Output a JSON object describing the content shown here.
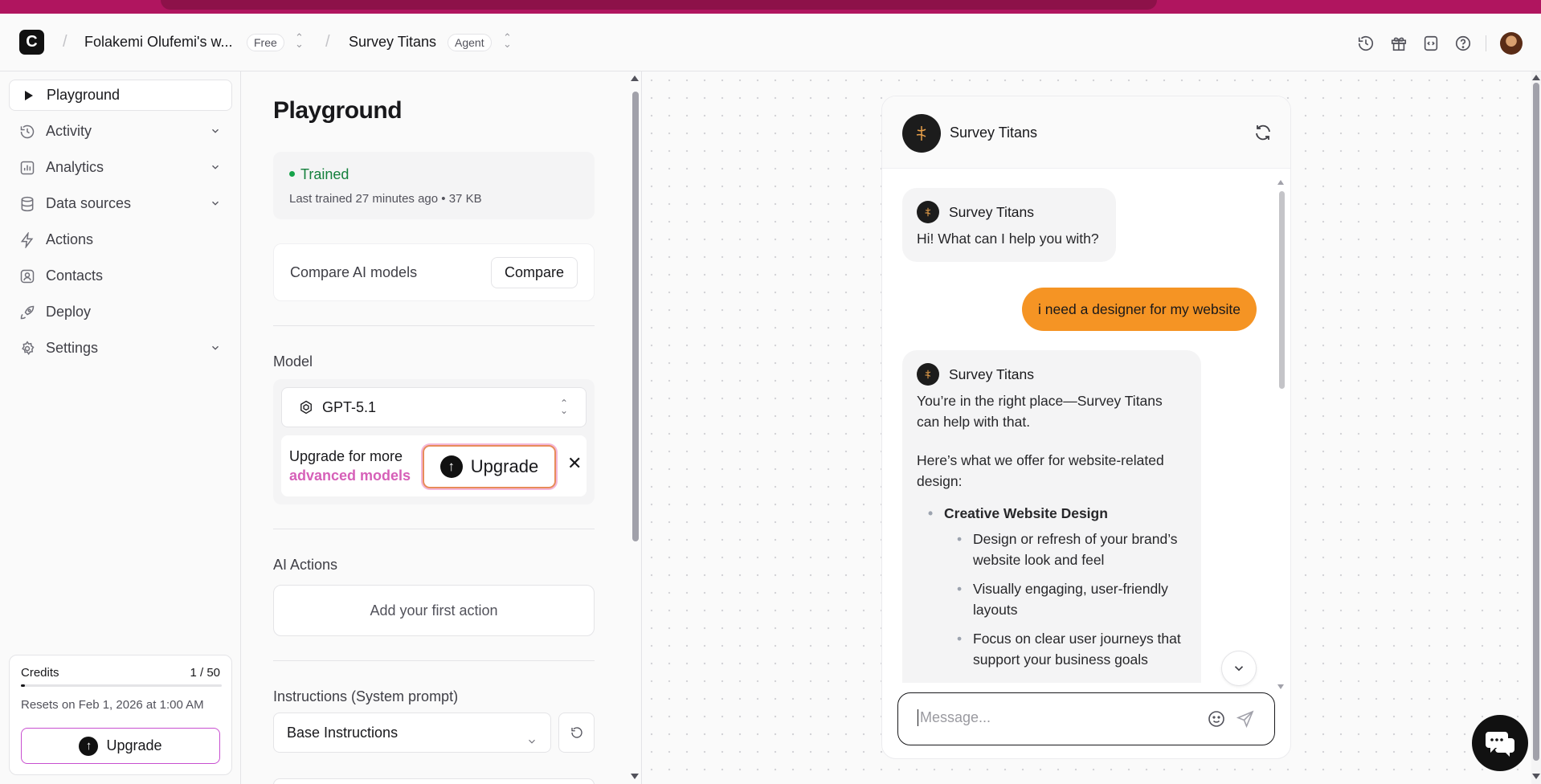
{
  "header": {
    "logo_letter": "C",
    "workspace_name": "Folakemi Olufemi's w...",
    "workspace_plan": "Free",
    "agent_name": "Survey Titans",
    "agent_badge": "Agent"
  },
  "sidebar": {
    "items": [
      {
        "label": "Playground"
      },
      {
        "label": "Activity"
      },
      {
        "label": "Analytics"
      },
      {
        "label": "Data sources"
      },
      {
        "label": "Actions"
      },
      {
        "label": "Contacts"
      },
      {
        "label": "Deploy"
      },
      {
        "label": "Settings"
      }
    ],
    "credits": {
      "label": "Credits",
      "count": "1 / 50",
      "used_fraction": 0.02,
      "reset_text": "Resets on Feb 1, 2026 at 1:00 AM",
      "upgrade_label": "Upgrade"
    }
  },
  "config": {
    "title": "Playground",
    "status": "Trained",
    "last_trained": "Last trained 27 minutes ago",
    "size": "37 KB",
    "compare_label": "Compare AI models",
    "compare_button": "Compare",
    "model_label": "Model",
    "model_value": "GPT-5.1",
    "upgrade_text_1": "Upgrade for more",
    "upgrade_text_2": "advanced models",
    "upgrade_button": "Upgrade",
    "actions_label": "AI Actions",
    "add_action": "Add your first action",
    "instructions_label": "Instructions (System prompt)",
    "instructions_value": "Base Instructions"
  },
  "chat": {
    "agent_name": "Survey Titans",
    "messages": [
      {
        "from": "bot",
        "name": "Survey Titans",
        "text": "Hi! What can I help you with?"
      },
      {
        "from": "user",
        "text": "i need a designer for my website"
      },
      {
        "from": "bot",
        "name": "Survey Titans",
        "p1": "You’re in the right place—Survey Titans can help with that.",
        "p2": "Here’s what we offer for website-related design:",
        "bullet": "Creative Website Design",
        "sub": [
          "Design or refresh of your brand’s website look and feel",
          "Visually engaging, user-friendly layouts",
          "Focus on clear user journeys that support your business goals"
        ]
      }
    ],
    "input_placeholder": "Message..."
  },
  "colors": {
    "accent_orange": "#f59424",
    "trained_green": "#15803d",
    "upgrade_pink": "#d660b8",
    "brand_magenta": "#b0155f"
  }
}
